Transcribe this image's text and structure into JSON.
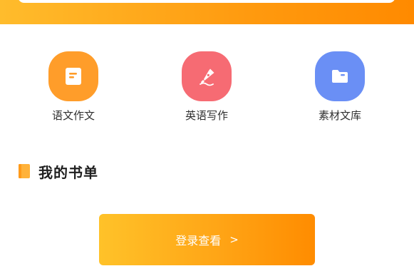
{
  "categories": [
    {
      "label": "语文作文",
      "icon": "document-icon",
      "color": "#ff9d2a"
    },
    {
      "label": "英语写作",
      "icon": "pen-icon",
      "color": "#f66b73"
    },
    {
      "label": "素材文库",
      "icon": "folder-icon",
      "color": "#6a8ff5"
    }
  ],
  "section": {
    "title": "我的书单",
    "icon": "book-icon",
    "icon_color": "#ffb23a"
  },
  "login": {
    "label": "登录查看",
    "arrow": ">"
  },
  "colors": {
    "banner_start": "#ffbc2c",
    "banner_end": "#ff8a00",
    "button_start": "#ffc229",
    "button_end": "#ff8c00"
  }
}
